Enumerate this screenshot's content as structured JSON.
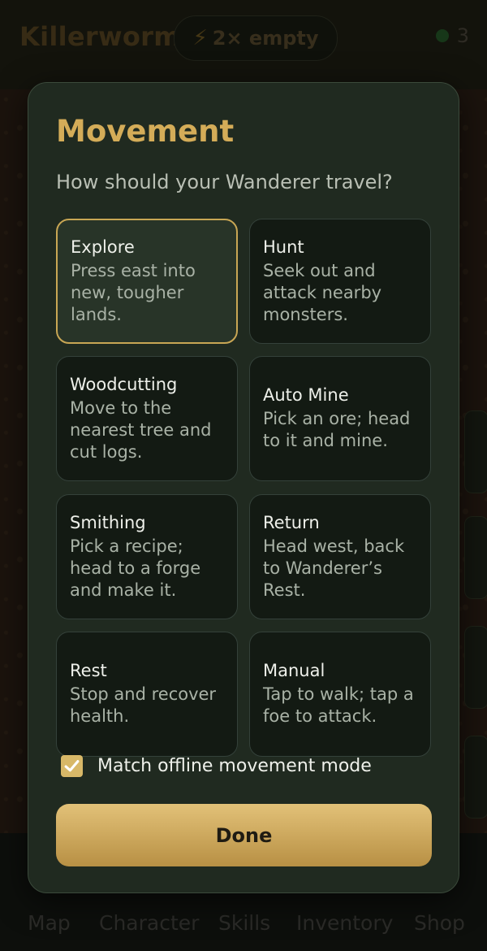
{
  "header": {
    "app_title": "Killerworm",
    "boost_icon": "lightning-bolt-icon",
    "boost_label": "2× empty",
    "counter_value": "3",
    "counter_color": "#1f4a22"
  },
  "modal": {
    "title": "Movement",
    "subtitle": "How should your Wanderer travel?",
    "options": [
      {
        "title": "Explore",
        "desc": "Press east into new, tougher lands.",
        "selected": true
      },
      {
        "title": "Hunt",
        "desc": "Seek out and attack nearby monsters.",
        "selected": false
      },
      {
        "title": "Woodcutting",
        "desc": "Move to the nearest tree and cut logs.",
        "selected": false
      },
      {
        "title": "Auto Mine",
        "desc": "Pick an ore; head to it and mine.",
        "selected": false
      },
      {
        "title": "Smithing",
        "desc": "Pick a recipe; head to a forge and make it.",
        "selected": false
      },
      {
        "title": "Return",
        "desc": "Head west, back to Wanderer’s Rest.",
        "selected": false
      },
      {
        "title": "Rest",
        "desc": "Stop and recover health.",
        "selected": false
      },
      {
        "title": "Manual",
        "desc": "Tap to walk; tap a foe to attack.",
        "selected": false
      }
    ],
    "checkbox": {
      "label": "Match offline movement mode",
      "checked": true
    },
    "done_label": "Done",
    "accent_color": "#d4ac58"
  },
  "nav": {
    "items": [
      "Map",
      "Character",
      "Skills",
      "Inventory",
      "Shop"
    ]
  }
}
